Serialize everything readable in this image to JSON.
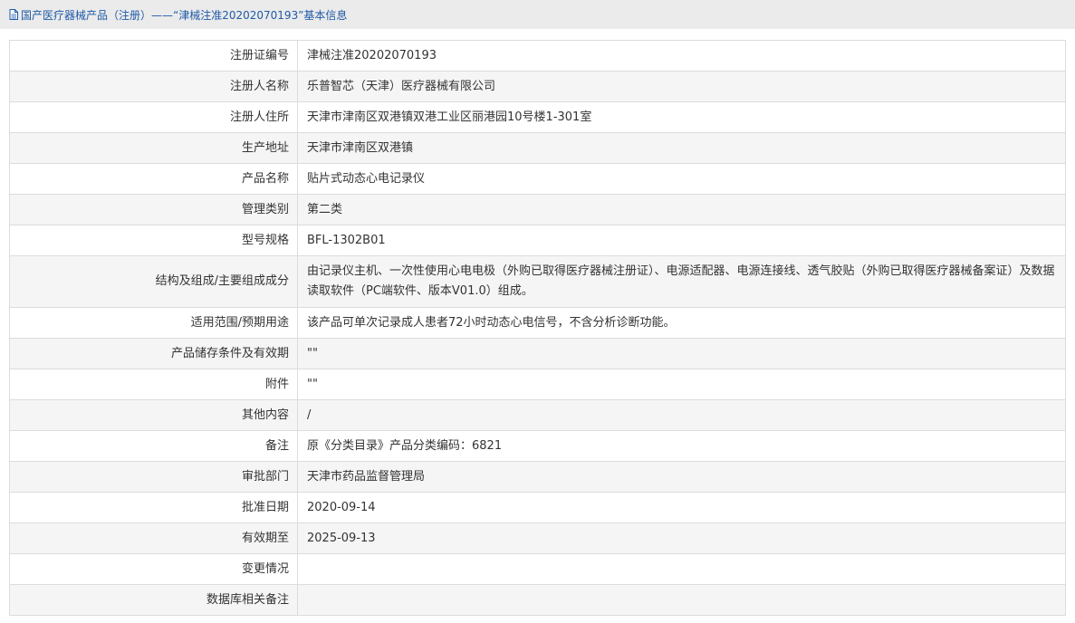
{
  "header": {
    "breadcrumb": "国产医疗器械产品（注册）——“津械注准20202070193”基本信息"
  },
  "rows": [
    {
      "label": "注册证编号",
      "value": "津械注准20202070193"
    },
    {
      "label": "注册人名称",
      "value": "乐普智芯（天津）医疗器械有限公司"
    },
    {
      "label": "注册人住所",
      "value": "天津市津南区双港镇双港工业区丽港园10号楼1-301室"
    },
    {
      "label": "生产地址",
      "value": "天津市津南区双港镇"
    },
    {
      "label": "产品名称",
      "value": "贴片式动态心电记录仪"
    },
    {
      "label": "管理类别",
      "value": "第二类"
    },
    {
      "label": "型号规格",
      "value": "BFL-1302B01"
    },
    {
      "label": "结构及组成/主要组成成分",
      "value": "由记录仪主机、一次性使用心电电极（外购已取得医疗器械注册证）、电源适配器、电源连接线、透气胶贴（外购已取得医疗器械备案证）及数据读取软件（PC端软件、版本V01.0）组成。"
    },
    {
      "label": "适用范围/预期用途",
      "value": "该产品可单次记录成人患者72小时动态心电信号，不含分析诊断功能。"
    },
    {
      "label": "产品储存条件及有效期",
      "value": "\"\""
    },
    {
      "label": "附件",
      "value": "\"\""
    },
    {
      "label": "其他内容",
      "value": "/"
    },
    {
      "label": "备注",
      "value": "原《分类目录》产品分类编码：6821"
    },
    {
      "label": "审批部门",
      "value": "天津市药品监督管理局"
    },
    {
      "label": "批准日期",
      "value": "2020-09-14"
    },
    {
      "label": "有效期至",
      "value": "2025-09-13"
    },
    {
      "label": "变更情况",
      "value": ""
    },
    {
      "label": "数据库相关备注",
      "value": ""
    }
  ]
}
